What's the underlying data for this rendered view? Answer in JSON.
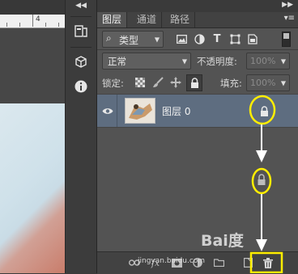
{
  "ruler": {
    "tick_label": "4"
  },
  "tabs": [
    {
      "label": "图层"
    },
    {
      "label": "通道"
    },
    {
      "label": "路径"
    }
  ],
  "filter": {
    "label": "类型"
  },
  "blend": {
    "mode": "正常",
    "opacity_label": "不透明度:",
    "opacity_value": "100%"
  },
  "lock": {
    "label": "锁定:",
    "fill_label": "填充:",
    "fill_value": "100%"
  },
  "layers": [
    {
      "name": "图层 0",
      "visible": true,
      "locked": true
    }
  ],
  "watermark": {
    "logo": "Bai度",
    "url": "jingyan.baidu.com"
  },
  "colors": {
    "highlight": "#ffee00",
    "selected_row": "#5e6d80"
  }
}
